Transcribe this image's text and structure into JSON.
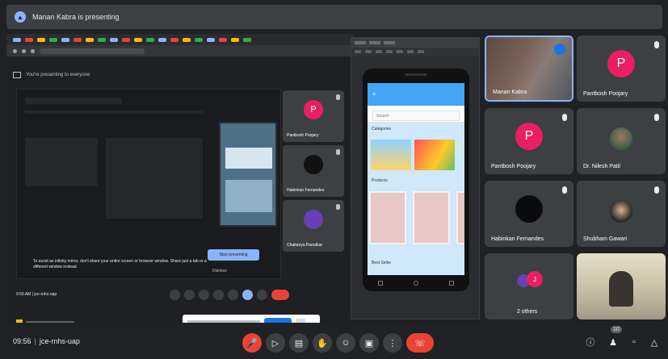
{
  "header": {
    "presenting_text": "Manan Kabra is presenting",
    "presenter_icon": "present-icon"
  },
  "shared_screen": {
    "notice_text": "You're presenting to everyone",
    "stop_presenting_label": "Stop presenting",
    "tip_text": "To avoid an infinity mirror, don't share your entire screen or browser window. Share just a tab or a different window instead.",
    "dismiss_label": "Dismiss",
    "inner_meeting_info": "9:56 AM | jce-rnhs-uap",
    "inner_tiles": [
      {
        "name": "Pantbosh Poojary",
        "initial": "P",
        "color": "#e91e63"
      },
      {
        "name": "Habinkan Fernandes",
        "initial": "",
        "color": "#111111"
      },
      {
        "name": "Chaitanya Paredkar",
        "initial": "",
        "color": "#6a3fb5"
      }
    ]
  },
  "emulator": {
    "search_placeholder": "Search",
    "section_category": "Categories",
    "section_products": "Products",
    "section_bottom": "Best Seller"
  },
  "participants": [
    {
      "name": "Manan Kabra",
      "kind": "video-person"
    },
    {
      "name": "Pantbosh Poojary",
      "initial": "P",
      "color": "#e91e63"
    },
    {
      "name": "Pantbosh Poojary",
      "initial": "P",
      "color": "#e91e63"
    },
    {
      "name": "Dr. Nilesh Patil",
      "kind": "photo"
    },
    {
      "name": "Habinkan Fernandes",
      "initial": "",
      "color": "#0b0b0f"
    },
    {
      "name": "Shubham Gawari",
      "kind": "photo"
    },
    {
      "name": "2 others",
      "initial": "J",
      "color": "#e91e63"
    },
    {
      "name": "",
      "kind": "video-camera"
    }
  ],
  "bottom_bar": {
    "time": "09:56",
    "meeting_code": "jce-rnhs-uap",
    "controls": [
      "mic-off-icon",
      "camera-icon",
      "captions-icon",
      "raise-hand-icon",
      "emoji-icon",
      "present-icon",
      "more-icon",
      "end-call-icon"
    ],
    "right_controls": [
      "info-icon",
      "people-icon",
      "chat-icon",
      "activities-icon"
    ],
    "people_count": "10"
  }
}
